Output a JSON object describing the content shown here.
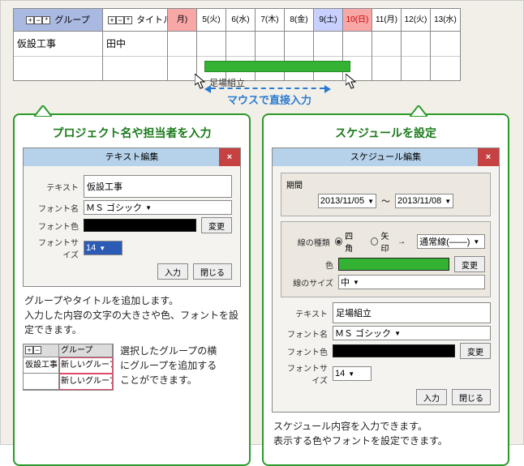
{
  "grid": {
    "group_header": "グループ",
    "title_header": "タイトル",
    "group_value": "仮設工事",
    "title_value": "田中"
  },
  "days": [
    {
      "label": "月)",
      "cls": "dmon"
    },
    {
      "label": "5(火)",
      "cls": ""
    },
    {
      "label": "6(水)",
      "cls": ""
    },
    {
      "label": "7(木)",
      "cls": ""
    },
    {
      "label": "8(金)",
      "cls": ""
    },
    {
      "label": "9(土)",
      "cls": "dsat"
    },
    {
      "label": "10(日)",
      "cls": "dsun"
    },
    {
      "label": "11(月)",
      "cls": ""
    },
    {
      "label": "12(火)",
      "cls": ""
    },
    {
      "label": "13(水)",
      "cls": ""
    }
  ],
  "gantt": {
    "label": "足場組立"
  },
  "mouse_hint": "マウスで直接入力",
  "left": {
    "title": "プロジェクト名や担当者を入力",
    "dialog_title": "テキスト編集",
    "text_label": "テキスト",
    "text_value": "仮設工事",
    "font_label": "フォント名",
    "font_value": "ＭＳ ゴシック",
    "color_label": "フォント色",
    "change_btn": "変更",
    "size_label": "フォントサイズ",
    "size_value": "14",
    "input_btn": "入力",
    "close_btn": "閉じる",
    "desc1": "グループやタイトルを追加します。\n入力した内容の文字の大きさや色、フォントを設定できます。",
    "mini": {
      "header": "グループ",
      "row1a": "仮設工事",
      "row1b": "新しいグループ",
      "row2b": "新しいグループ"
    },
    "desc2": "選択したグループの横にグループを追加することができます。"
  },
  "right": {
    "title": "スケジュールを設定",
    "dialog_title": "スケジュール編集",
    "period_label": "期間",
    "date_from": "2013/11/05",
    "date_sep": "～",
    "date_to": "2013/11/08",
    "line_type_label": "線の種類",
    "opt_rect": "四角",
    "opt_arrow": "矢印",
    "line_style_value": "通常線(――)",
    "color_label": "色",
    "change_btn": "変更",
    "line_size_label": "線のサイズ",
    "line_size_value": "中",
    "text_label": "テキスト",
    "text_value": "足場組立",
    "font_label": "フォント名",
    "font_value": "ＭＳ ゴシック",
    "fontcolor_label": "フォント色",
    "size_label": "フォントサイズ",
    "size_value": "14",
    "input_btn": "入力",
    "close_btn": "閉じる",
    "desc": "スケジュール内容を入力できます。\n表示する色やフォントを設定できます。"
  }
}
